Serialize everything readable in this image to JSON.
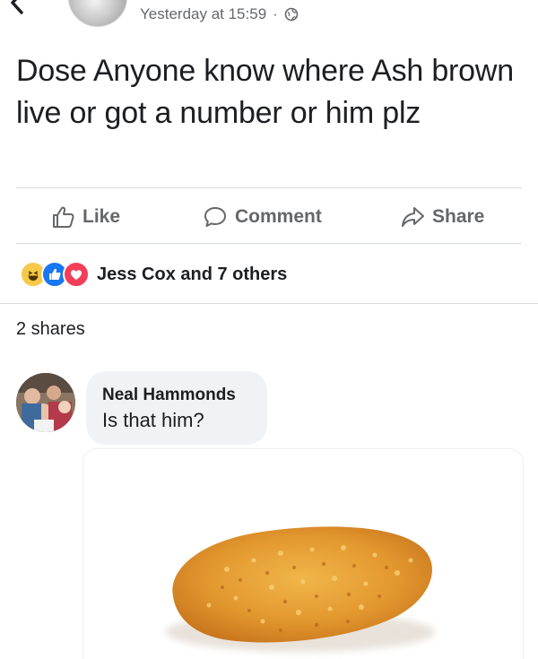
{
  "post": {
    "timestamp": "Yesterday at 15:59",
    "separator": "·",
    "privacy_icon": "globe-icon",
    "text": "Dose Anyone know where Ash brown live or got a number or him plz"
  },
  "actions": {
    "like": "Like",
    "comment": "Comment",
    "share": "Share"
  },
  "reactions": {
    "icons": [
      "haha-icon",
      "like-reaction-icon",
      "love-reaction-icon"
    ],
    "summary": "Jess Cox and 7 others"
  },
  "shares": "2 shares",
  "comment": {
    "author": "Neal Hammonds",
    "text": "Is that him?",
    "attachment": "hash-brown-image"
  },
  "colors": {
    "text": "#1c1e21",
    "secondary_text": "#65676b",
    "bubble": "#f0f2f5",
    "divider": "#dadde1",
    "like_blue": "#1877f2",
    "love_red": "#f33e58",
    "haha_yellow": "#f7c948"
  }
}
